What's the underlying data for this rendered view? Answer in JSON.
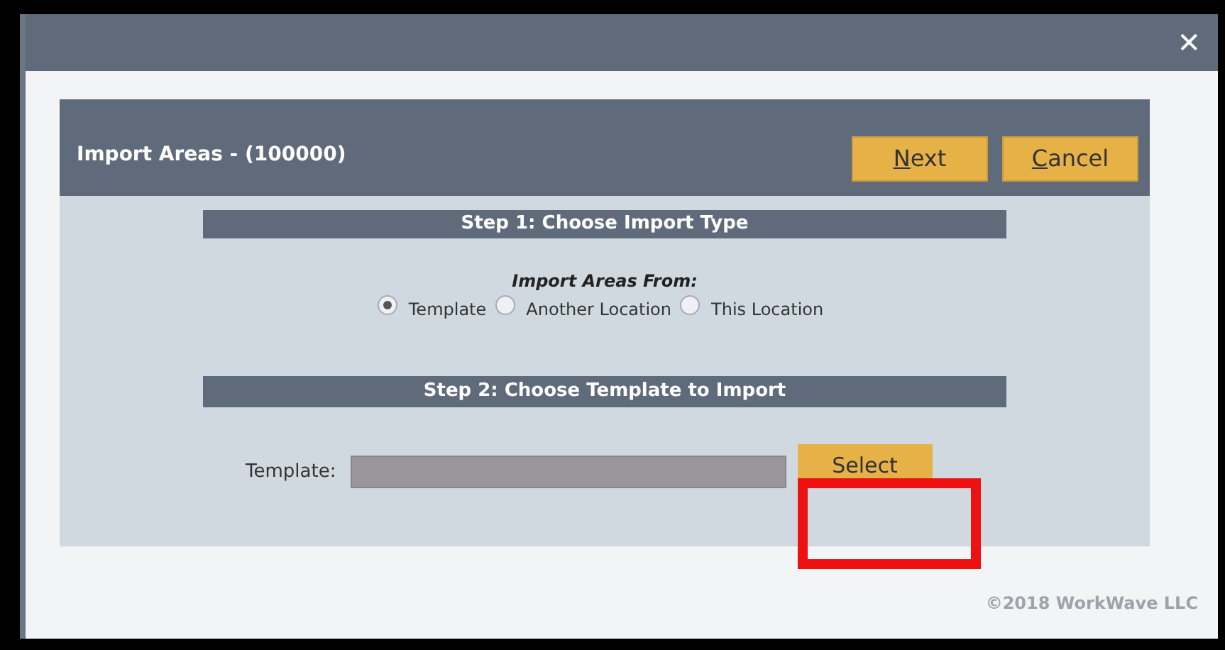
{
  "window": {
    "close": "✕"
  },
  "dialog": {
    "title": "Import Areas - (100000)",
    "buttons": [
      {
        "label": "Next"
      },
      {
        "label": "Cancel"
      }
    ]
  },
  "step1": {
    "heading": "Step 1: Choose Import Type",
    "prompt": "Import Areas From:",
    "options": [
      {
        "label": "Template",
        "selected": true
      },
      {
        "label": "Another Location",
        "selected": false
      },
      {
        "label": "This Location",
        "selected": false
      }
    ]
  },
  "step2": {
    "heading": "Step 2: Choose Template to Import",
    "field_label": "Template:",
    "button": "Select"
  },
  "footer": "©2018 WorkWave LLC"
}
